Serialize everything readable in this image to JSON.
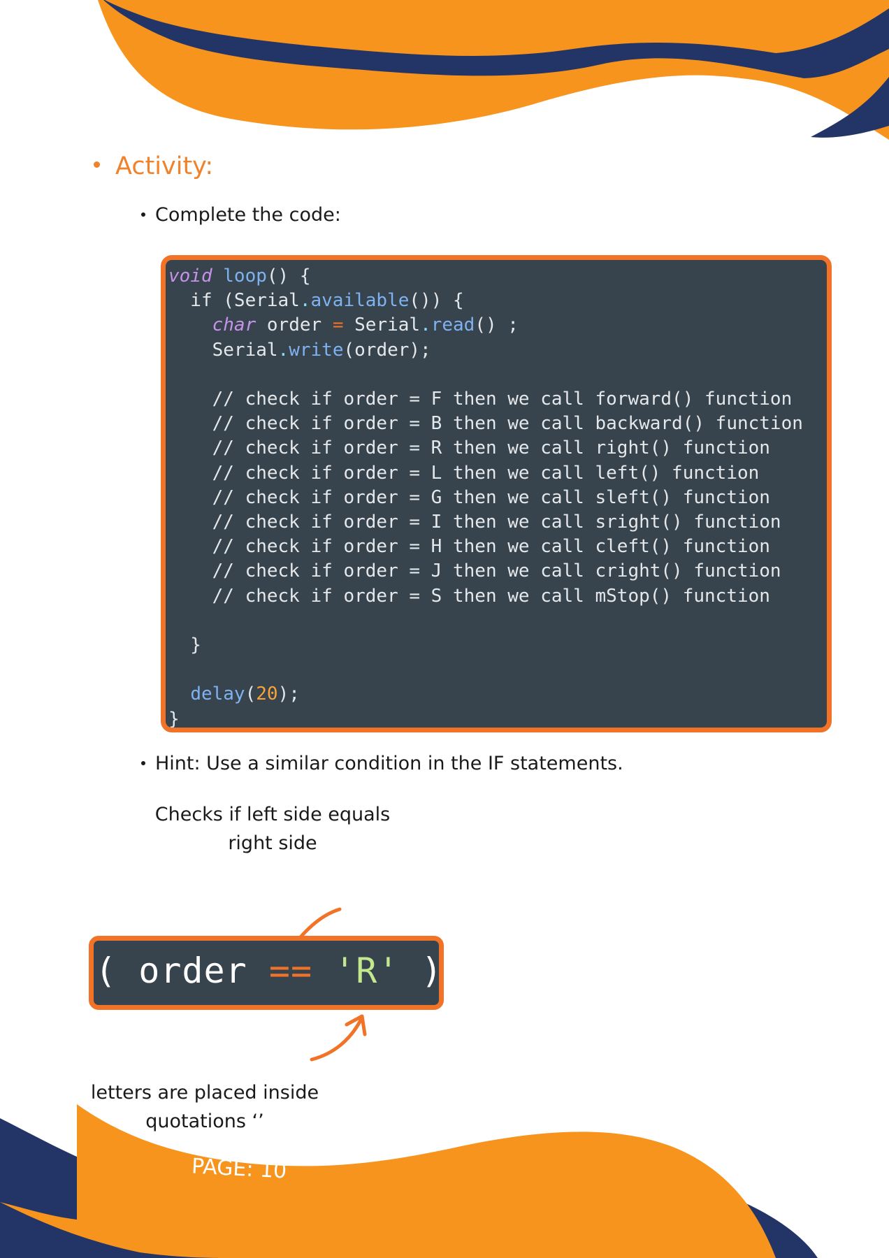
{
  "activity": {
    "title": "Activity:"
  },
  "instruction": {
    "text": "Complete the code:"
  },
  "code": {
    "lines": [
      "void loop() {",
      "  if (Serial.available()) {",
      "    char order = Serial.read() ;",
      "    Serial.write(order);",
      "",
      "    // check if order = F then we call forward() function",
      "    // check if order = B then we call backward() function",
      "    // check if order = R then we call right() function",
      "    // check if order = L then we call left() function",
      "    // check if order = G then we call sleft() function",
      "    // check if order = I then we call sright() function",
      "    // check if order = H then we call cleft() function",
      "    // check if order = J then we call cright() function",
      "    // check if order = S then we call mStop() function",
      "",
      "  }",
      "",
      "  delay(20);",
      "}"
    ]
  },
  "hint": {
    "text": "Hint: Use a similar condition in the IF statements."
  },
  "annotation_top": {
    "line1": "Checks if left side equals",
    "line2": "right side"
  },
  "snippet": {
    "open": "( ",
    "var": "order",
    "op": "==",
    "literal": "'R'",
    "close": " )"
  },
  "annotation_bottom": {
    "line1": "letters are placed inside",
    "line2": "quotations ‘’"
  },
  "page": {
    "label": "PAGE: 10"
  },
  "colors": {
    "orange": "#f7941d",
    "navy": "#233467",
    "code_bg": "#37434d",
    "border": "#f07327"
  }
}
